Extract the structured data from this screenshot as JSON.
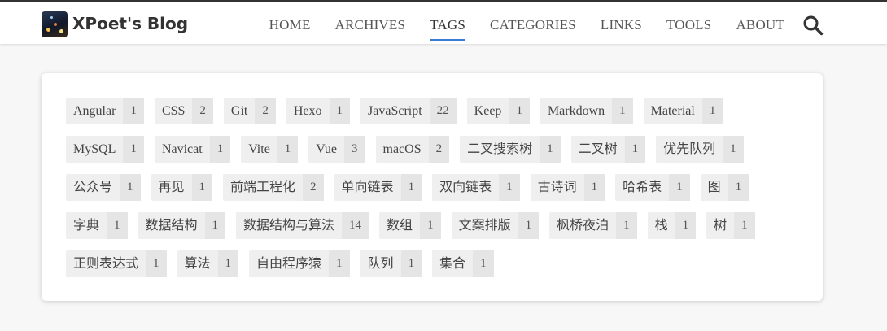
{
  "header": {
    "site_title": "XPoet's Blog",
    "nav": [
      "HOME",
      "ARCHIVES",
      "TAGS",
      "CATEGORIES",
      "LINKS",
      "TOOLS",
      "ABOUT"
    ],
    "active_nav": "TAGS"
  },
  "colors": {
    "accent": "#3a7bd5",
    "tag_bg": "#efefef",
    "count_bg": "#e5e5e5"
  },
  "tags": [
    {
      "name": "Angular",
      "count": "1"
    },
    {
      "name": "CSS",
      "count": "2"
    },
    {
      "name": "Git",
      "count": "2"
    },
    {
      "name": "Hexo",
      "count": "1"
    },
    {
      "name": "JavaScript",
      "count": "22"
    },
    {
      "name": "Keep",
      "count": "1"
    },
    {
      "name": "Markdown",
      "count": "1"
    },
    {
      "name": "Material",
      "count": "1"
    },
    {
      "name": "MySQL",
      "count": "1"
    },
    {
      "name": "Navicat",
      "count": "1"
    },
    {
      "name": "Vite",
      "count": "1"
    },
    {
      "name": "Vue",
      "count": "3"
    },
    {
      "name": "macOS",
      "count": "2"
    },
    {
      "name": "二叉搜索树",
      "count": "1"
    },
    {
      "name": "二叉树",
      "count": "1"
    },
    {
      "name": "优先队列",
      "count": "1"
    },
    {
      "name": "公众号",
      "count": "1"
    },
    {
      "name": "再见",
      "count": "1"
    },
    {
      "name": "前端工程化",
      "count": "2"
    },
    {
      "name": "单向链表",
      "count": "1"
    },
    {
      "name": "双向链表",
      "count": "1"
    },
    {
      "name": "古诗词",
      "count": "1"
    },
    {
      "name": "哈希表",
      "count": "1"
    },
    {
      "name": "图",
      "count": "1"
    },
    {
      "name": "字典",
      "count": "1"
    },
    {
      "name": "数据结构",
      "count": "1"
    },
    {
      "name": "数据结构与算法",
      "count": "14"
    },
    {
      "name": "数组",
      "count": "1"
    },
    {
      "name": "文案排版",
      "count": "1"
    },
    {
      "name": "枫桥夜泊",
      "count": "1"
    },
    {
      "name": "栈",
      "count": "1"
    },
    {
      "name": "树",
      "count": "1"
    },
    {
      "name": "正则表达式",
      "count": "1"
    },
    {
      "name": "算法",
      "count": "1"
    },
    {
      "name": "自由程序猿",
      "count": "1"
    },
    {
      "name": "队列",
      "count": "1"
    },
    {
      "name": "集合",
      "count": "1"
    }
  ]
}
